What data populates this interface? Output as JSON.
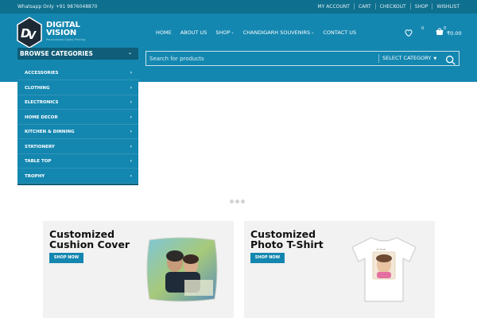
{
  "topbar": {
    "whatsapp": "Whatsapp Only +91 9876048870",
    "links": [
      "MY ACCOUNT",
      "CART",
      "CHECKOUT",
      "SHOP",
      "WISHLIST"
    ]
  },
  "logo": {
    "line1": "DIGITAL",
    "line2": "VISION",
    "tagline": "Personalized Digital Printing"
  },
  "nav": {
    "items": [
      "HOME",
      "ABOUT US",
      "SHOP",
      "CHANDIGARH SOUVENIRS",
      "CONTACT US"
    ]
  },
  "header": {
    "wishlist_count": "0",
    "cart_count": "0",
    "cart_total": "₹0.00"
  },
  "browse": {
    "label": "BROWSE CATEGORIES",
    "categories": [
      "ACCESSORIES",
      "CLOTHING",
      "ELECTRONICS",
      "HOME DECOR",
      "KITCHEN & DINNING",
      "STATIONERY",
      "TABLE TOP",
      "TROPHY"
    ]
  },
  "search": {
    "placeholder": "Search for products",
    "category": "SELECT CATEGORY"
  },
  "promos": [
    {
      "title": "Customized Cushion Cover",
      "button": "SHOP NOW"
    },
    {
      "title": "Customized Photo T-Shirt",
      "button": "SHOP NOW"
    }
  ],
  "colors": {
    "primary": "#1487b0",
    "topbar": "#0e6f8e",
    "browse_header": "#0f5d78",
    "card_bg": "#f2f2f2"
  }
}
